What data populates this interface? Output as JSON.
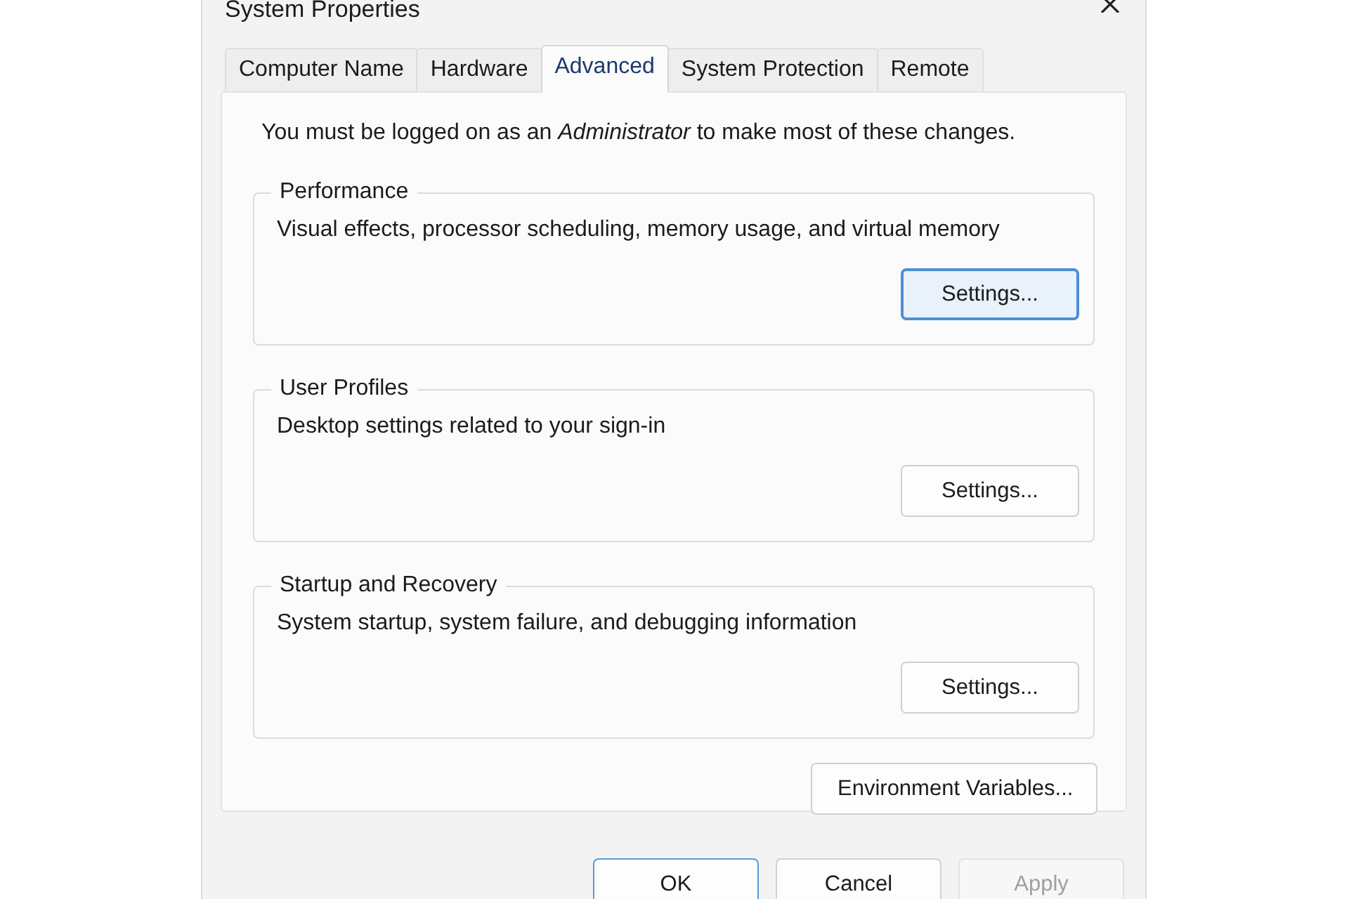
{
  "window": {
    "title": "System Properties"
  },
  "tabs": [
    {
      "label": "Computer Name",
      "selected": false
    },
    {
      "label": "Hardware",
      "selected": false
    },
    {
      "label": "Advanced",
      "selected": true
    },
    {
      "label": "System Protection",
      "selected": false
    },
    {
      "label": "Remote",
      "selected": false
    }
  ],
  "notice": "You must be logged on as an *Administrator* to make most of these changes.",
  "groups": [
    {
      "title": "Performance",
      "description": "Visual effects, processor scheduling, memory usage, and virtual memory",
      "button": {
        "label": "Settings...",
        "focused": true
      }
    },
    {
      "title": "User Profiles",
      "description": "Desktop settings related to your sign-in",
      "button": {
        "label": "Settings...",
        "focused": false
      }
    },
    {
      "title": "Startup and Recovery",
      "description": "System startup, system failure, and debugging information",
      "button": {
        "label": "Settings...",
        "focused": false
      }
    }
  ],
  "environment_button": {
    "label": "Environment Variables..."
  },
  "buttons": [
    {
      "label": "OK",
      "default": true,
      "disabled": false
    },
    {
      "label": "Cancel",
      "default": false,
      "disabled": false
    },
    {
      "label": "Apply",
      "default": false,
      "disabled": true
    }
  ]
}
